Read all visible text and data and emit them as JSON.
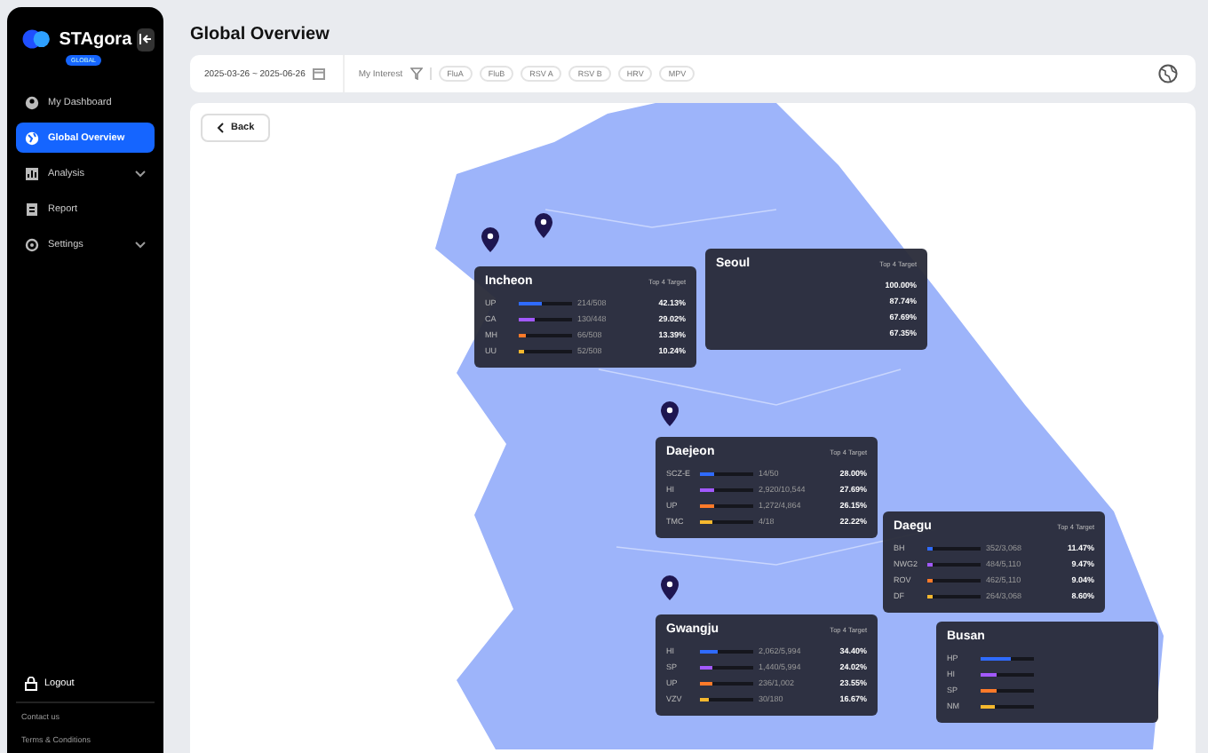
{
  "sidebar": {
    "brand": "STAgora",
    "badge": "GLOBAL",
    "items": [
      {
        "label": "My Dashboard",
        "selected": false,
        "expandable": false
      },
      {
        "label": "Global Overview",
        "selected": true,
        "expandable": false
      },
      {
        "label": "Analysis",
        "selected": false,
        "expandable": true
      },
      {
        "label": "Report",
        "selected": false,
        "expandable": false
      },
      {
        "label": "Settings",
        "selected": false,
        "expandable": true
      }
    ],
    "logout": "Logout",
    "footer_links": [
      "Contact us",
      "Terms & Conditions"
    ]
  },
  "title": "Global Overview",
  "filter_bar": {
    "date_range": "2025-03-26 ~ 2025-06-26",
    "interest_label": "My Interest",
    "chips": [
      "FluA",
      "FluB",
      "RSV A",
      "RSV B",
      "HRV",
      "MPV"
    ]
  },
  "back_button": "Back",
  "regions": [
    {
      "name": "Incheon",
      "target_label": "Top 4 Target",
      "rows": [
        {
          "label": "UP",
          "count": "214/508",
          "pct": "42.13%",
          "level": 0.42,
          "color": "#2f6bff"
        },
        {
          "label": "CA",
          "count": "130/448",
          "pct": "29.02%",
          "level": 0.29,
          "color": "#a259ff"
        },
        {
          "label": "MH",
          "count": "66/508",
          "pct": "13.39%",
          "level": 0.13,
          "color": "#ff7a29"
        },
        {
          "label": "UU",
          "count": "52/508",
          "pct": "10.24%",
          "level": 0.1,
          "color": "#f5b82e"
        }
      ]
    },
    {
      "name": "Seoul",
      "target_label": "Top 4 Target",
      "rows": [
        {
          "pct": "100.00%"
        },
        {
          "pct": "87.74%"
        },
        {
          "pct": "67.69%"
        },
        {
          "pct": "67.35%"
        }
      ]
    },
    {
      "name": "Daejeon",
      "target_label": "Top 4 Target",
      "rows": [
        {
          "label": "SCZ-E",
          "count": "14/50",
          "pct": "28.00%",
          "level": 0.28,
          "color": "#2f6bff"
        },
        {
          "label": "HI",
          "count": "2,920/10,544",
          "pct": "27.69%",
          "level": 0.28,
          "color": "#a259ff"
        },
        {
          "label": "UP",
          "count": "1,272/4,864",
          "pct": "26.15%",
          "level": 0.26,
          "color": "#ff7a29"
        },
        {
          "label": "TMC",
          "count": "4/18",
          "pct": "22.22%",
          "level": 0.22,
          "color": "#f5b82e"
        }
      ]
    },
    {
      "name": "Daegu",
      "target_label": "Top 4 Target",
      "rows": [
        {
          "label": "BH",
          "count": "352/3,068",
          "pct": "11.47%",
          "level": 0.11,
          "color": "#2f6bff"
        },
        {
          "label": "NWG2",
          "count": "484/5,110",
          "pct": "9.47%",
          "level": 0.09,
          "color": "#a259ff"
        },
        {
          "label": "ROV",
          "count": "462/5,110",
          "pct": "9.04%",
          "level": 0.09,
          "color": "#ff7a29"
        },
        {
          "label": "DF",
          "count": "264/3,068",
          "pct": "8.60%",
          "level": 0.09,
          "color": "#f5b82e"
        }
      ]
    },
    {
      "name": "Gwangju",
      "target_label": "Top 4 Target",
      "rows": [
        {
          "label": "HI",
          "count": "2,062/5,994",
          "pct": "34.40%",
          "level": 0.34,
          "color": "#2f6bff"
        },
        {
          "label": "SP",
          "count": "1,440/5,994",
          "pct": "24.02%",
          "level": 0.24,
          "color": "#a259ff"
        },
        {
          "label": "UP",
          "count": "236/1,002",
          "pct": "23.55%",
          "level": 0.24,
          "color": "#ff7a29"
        },
        {
          "label": "VZV",
          "count": "30/180",
          "pct": "16.67%",
          "level": 0.17,
          "color": "#f5b82e"
        }
      ]
    },
    {
      "name": "Busan",
      "rows": [
        {
          "label": "HP",
          "level": 0.55,
          "color": "#2f6bff"
        },
        {
          "label": "HI",
          "level": 0.3,
          "color": "#a259ff"
        },
        {
          "label": "SP",
          "level": 0.3,
          "color": "#ff7a29"
        },
        {
          "label": "NM",
          "level": 0.25,
          "color": "#f5b82e"
        }
      ]
    }
  ]
}
